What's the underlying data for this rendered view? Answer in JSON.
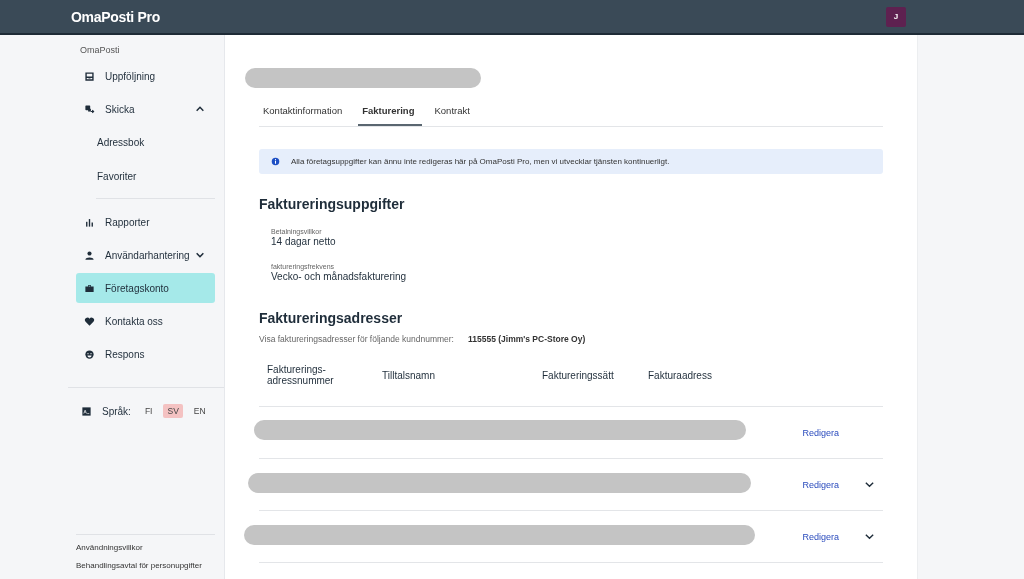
{
  "header": {
    "logo": "OmaPosti Pro",
    "avatar": "J"
  },
  "sidebar": {
    "section": "OmaPosti",
    "items": [
      {
        "label": "Uppföljning",
        "selected": false
      },
      {
        "label": "Skicka",
        "selected": false,
        "expanded": true,
        "children": [
          {
            "label": "Adressbok",
            "selected": false
          },
          {
            "label": "Favoriter",
            "selected": false
          }
        ]
      },
      {
        "label": "Rapporter",
        "selected": false
      },
      {
        "label": "Användarhantering",
        "selected": false,
        "expanded": false
      },
      {
        "label": "Företagskonto",
        "selected": true
      },
      {
        "label": "Kontakta oss",
        "selected": false
      },
      {
        "label": "Respons",
        "selected": false
      }
    ],
    "language_label": "Språk:",
    "languages": [
      {
        "label": "FI",
        "selected": false
      },
      {
        "label": "SV",
        "selected": true
      },
      {
        "label": "EN",
        "selected": false
      }
    ],
    "footer_links": [
      "Användningsvillkor",
      "Behandlingsavtal för personupgifter"
    ]
  },
  "tabs": [
    {
      "label": "Kontaktinformation",
      "selected": false
    },
    {
      "label": "Fakturering",
      "selected": true
    },
    {
      "label": "Kontrakt",
      "selected": false
    }
  ],
  "notice": "Alla företagsuppgifter kan ännu inte redigeras här på OmaPosti Pro, men vi utvecklar tjänsten kontinuerligt.",
  "billing_details": {
    "title": "Faktureringsuppgifter",
    "fields": [
      {
        "label": "Betalningsvillkor",
        "value": "14 dagar netto"
      },
      {
        "label": "faktureringsfrekvens",
        "value": "Vecko- och månadsfakturering"
      }
    ]
  },
  "billing_addresses": {
    "title": "Faktureringsadresser",
    "filter_label": "Visa faktureringsadresser för följande kundnummer:",
    "customer": "115555 (Jimm's PC-Store Oy)",
    "columns": [
      "Fakturerings-adressnummer",
      "Tilltalsnamn",
      "Faktureringssätt",
      "Fakturaadress"
    ],
    "rows": [
      {
        "action": "Redigera",
        "expandable": false
      },
      {
        "action": "Redigera",
        "expandable": true
      },
      {
        "action": "Redigera",
        "expandable": true
      }
    ]
  }
}
